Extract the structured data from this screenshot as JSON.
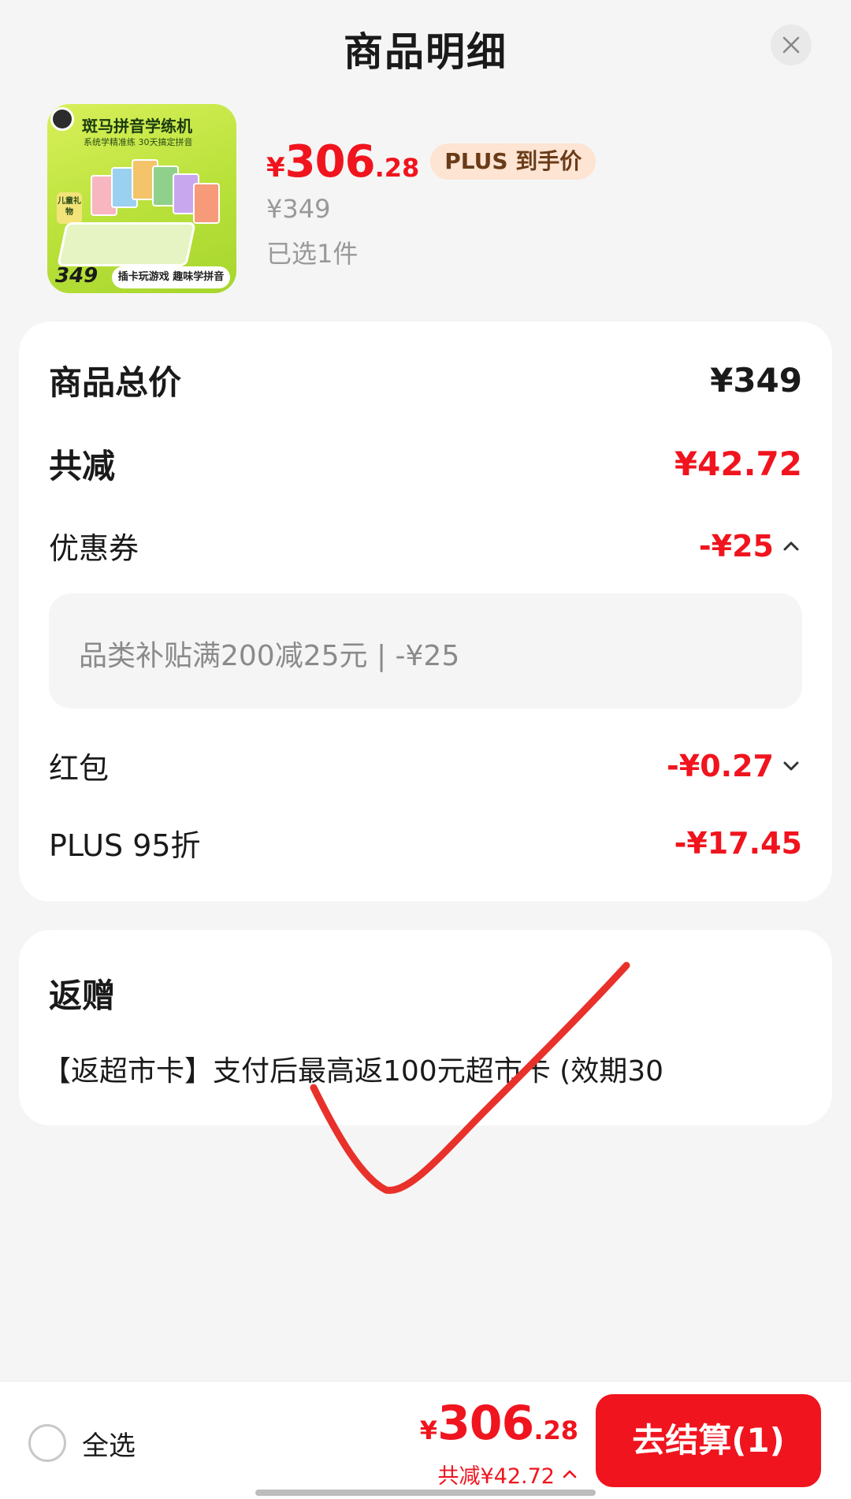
{
  "header": {
    "title": "商品明细",
    "close_icon": "close-icon"
  },
  "product": {
    "image": {
      "title": "斑马拼音学练机",
      "subtitle": "系统学精准练 30天搞定拼音",
      "badge": "儿童礼物",
      "price": "349",
      "footer": "插卡玩游戏 趣味学拼音"
    },
    "price_currency": "¥",
    "price_int": "306",
    "price_dec": ".28",
    "plus_badge": "PLUS 到手价",
    "original_price": "¥349",
    "selected_count": "已选1件"
  },
  "breakdown": {
    "total_label": "商品总价",
    "total_value": "¥349",
    "discount_label": "共减",
    "discount_value": "¥42.72",
    "coupon_label": "优惠券",
    "coupon_value": "-¥25",
    "coupon_detail": "品类补贴满200减25元 | -¥25",
    "redpacket_label": "红包",
    "redpacket_value": "-¥0.27",
    "plus_label": "PLUS 95折",
    "plus_value": "-¥17.45"
  },
  "gift": {
    "title": "返赠",
    "text": "【返超市卡】支付后最高返100元超市卡 (效期30"
  },
  "bottom_bar": {
    "select_all": "全选",
    "total_currency": "¥",
    "total_int": "306",
    "total_dec": ".28",
    "total_discount": "共减¥42.72",
    "checkout": "去结算(1)"
  },
  "colors": {
    "accent_red": "#f0141e",
    "plus_badge_bg": "#fde4d3",
    "plus_badge_text": "#6a3b18",
    "muted_text": "#999999",
    "handwritten_mark": "#e8312a"
  }
}
